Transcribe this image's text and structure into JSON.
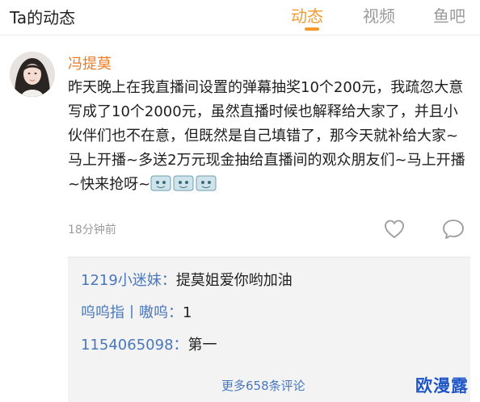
{
  "header": {
    "title": "Ta的动态",
    "tabs": [
      {
        "label": "动态",
        "active": true
      },
      {
        "label": "视频",
        "active": false
      },
      {
        "label": "鱼吧",
        "active": false
      }
    ]
  },
  "post": {
    "author": "冯提莫",
    "content": "昨天晚上在我直播间设置的弹幕抽奖10个200元，我疏忽大意写成了10个2000元，虽然直播时候也解释给大家了，并且小伙伴们也不在意，但既然是自己填错了，那今天就补给大家~马上开播~多送2万元现金抽给直播间的观众朋友们~马上开播~快来抢呀~",
    "emoji_count": 3,
    "time": "18分钟前",
    "icons": {
      "like": "heart-icon",
      "comment": "comment-icon"
    }
  },
  "comments": [
    {
      "name": "1219小迷妹",
      "sep": "：",
      "text": "提莫姐爱你哟加油"
    },
    {
      "name": "呜呜指丨嗷呜",
      "sep": "：",
      "text": "1"
    },
    {
      "name": "1154065098",
      "sep": "：",
      "text": "第一"
    }
  ],
  "more_comments": "更多658条评论",
  "watermark": "欧漫露",
  "colors": {
    "accent": "#f39a2b",
    "author": "#f07a20",
    "link": "#4a77bd",
    "watermark": "#1f56c4"
  }
}
